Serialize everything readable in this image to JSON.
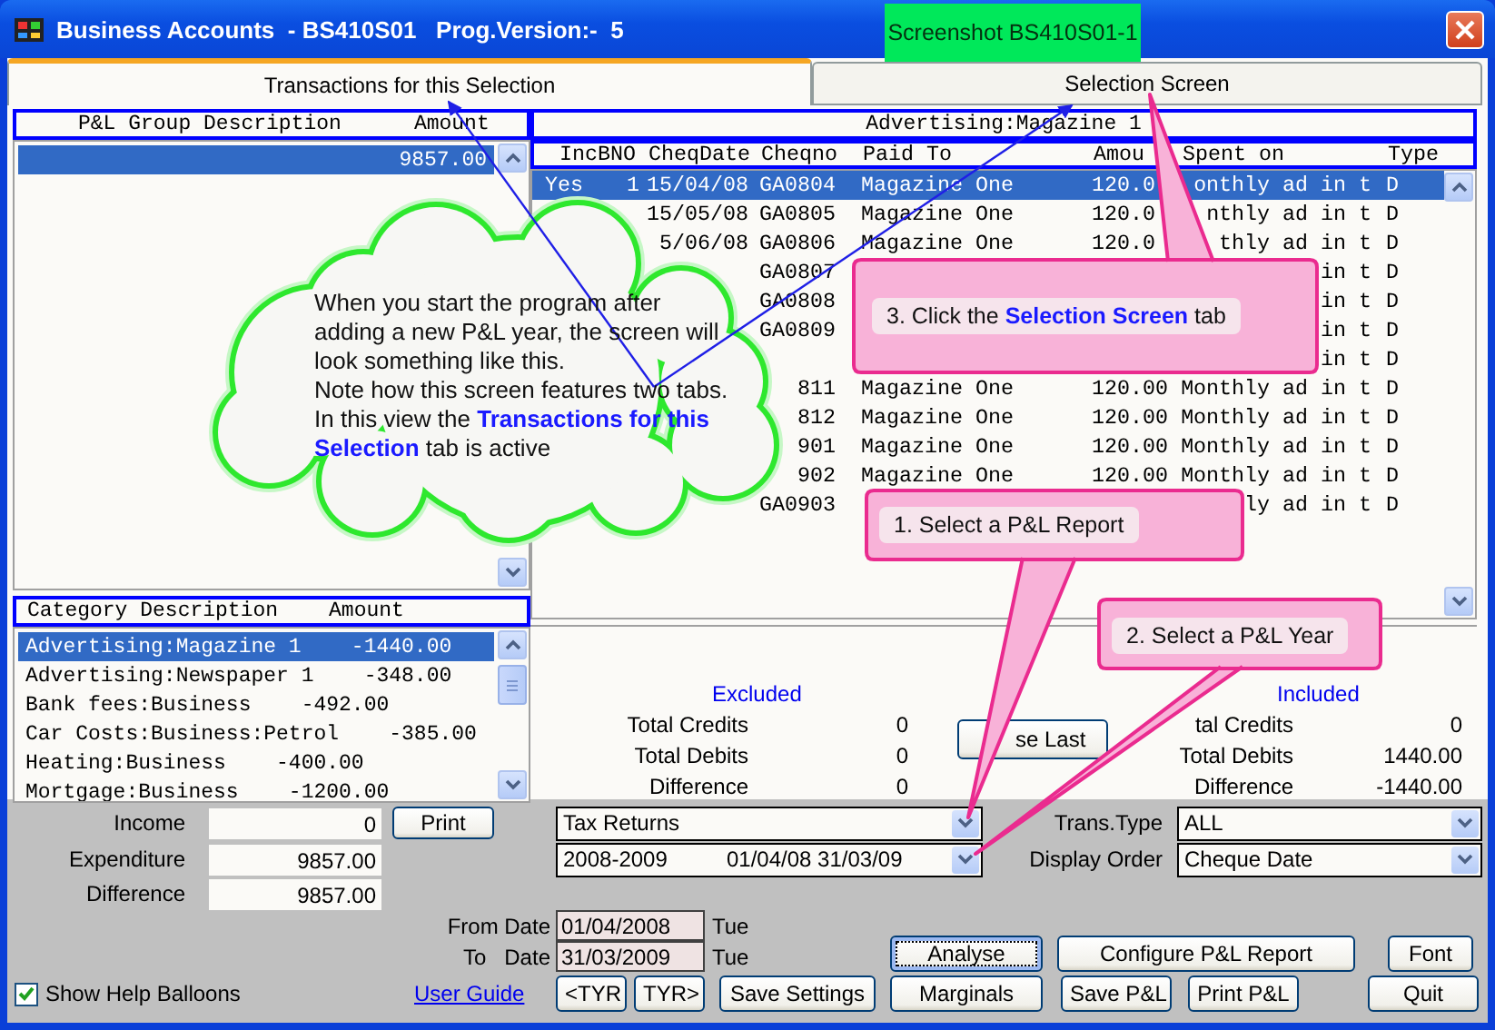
{
  "window": {
    "title": "Business Accounts  - BS410S01   Prog.Version:-  5"
  },
  "tabs": [
    {
      "label": "Transactions for this Selection",
      "selected": true
    },
    {
      "label": "Selection Screen",
      "selected": false
    }
  ],
  "group_list": {
    "columns": [
      "P&L Group Description",
      "Amount"
    ],
    "rows": [
      {
        "amount": "9857.00",
        "selected": true
      }
    ]
  },
  "category_list": {
    "columns": [
      "Category Description",
      "Amount"
    ],
    "rows": [
      {
        "description": "Advertising:Magazine 1",
        "amount": "-1440.00",
        "selected": true
      },
      {
        "description": "Advertising:Newspaper 1",
        "amount": "-348.00",
        "selected": false
      },
      {
        "description": "Bank fees:Business",
        "amount": "-492.00",
        "selected": false
      },
      {
        "description": "Car Costs:Business:Petrol",
        "amount": "-385.00",
        "selected": false
      },
      {
        "description": "Heating:Business",
        "amount": "-400.00",
        "selected": false
      },
      {
        "description": "Mortgage:Business",
        "amount": "-1200.00",
        "selected": false
      }
    ]
  },
  "transactions": {
    "title": "Advertising:Magazine 1",
    "columns": [
      "Inc",
      "BNO",
      "CheqDate",
      "Cheqno",
      "Paid To",
      "Amou",
      "Spent on",
      "Type"
    ],
    "rows": [
      {
        "inc": "Yes",
        "bno": "1",
        "date": "15/04/08",
        "cheqno": "GA0804",
        "paid_to": "Magazine One",
        "amount": "120.0",
        "spent_on": "onthly ad in t",
        "type": "D",
        "selected": true
      },
      {
        "date": "15/05/08",
        "cheqno": "GA0805",
        "paid_to": "Magazine One",
        "amount": "120.0",
        "spent_on": "nthly ad in t",
        "type": "D",
        "selected": false
      },
      {
        "date": "5/06/08",
        "cheqno": "GA0806",
        "paid_to": "Magazine One",
        "amount": "120.0",
        "spent_on": "thly ad in t",
        "type": "D",
        "selected": false
      },
      {
        "cheqno": "GA0807",
        "spent_on": "in t",
        "type": "D",
        "selected": false
      },
      {
        "cheqno": "GA0808",
        "spent_on": "in t",
        "type": "D",
        "selected": false
      },
      {
        "cheqno": "GA0809",
        "spent_on": "in t",
        "type": "D",
        "selected": false
      },
      {
        "spent_on": "in t",
        "type": "D",
        "selected": false
      },
      {
        "cheqno": "811",
        "paid_to": "Magazine One",
        "amount": "120.00",
        "spent_on": "Monthly ad in t",
        "type": "D",
        "selected": false
      },
      {
        "cheqno": "812",
        "paid_to": "Magazine One",
        "amount": "120.00",
        "spent_on": "Monthly ad in t",
        "type": "D",
        "selected": false
      },
      {
        "cheqno": "901",
        "paid_to": "Magazine One",
        "amount": "120.00",
        "spent_on": "Monthly ad in t",
        "type": "D",
        "selected": false
      },
      {
        "cheqno": "902",
        "paid_to": "Magazine One",
        "amount": "120.00",
        "spent_on": "Monthly ad in t",
        "type": "D",
        "selected": false
      },
      {
        "cheqno": "GA0903",
        "spent_on": "ly ad in t",
        "type": "D",
        "selected": false
      }
    ]
  },
  "summary": {
    "excluded": {
      "heading": "Excluded",
      "rows": [
        {
          "label": "Total Credits",
          "value": "0"
        },
        {
          "label": "Total Debits",
          "value": "0"
        },
        {
          "label": "Difference",
          "value": "0"
        }
      ]
    },
    "use_last": "se Last",
    "included": {
      "heading": "Included",
      "rows": [
        {
          "label": "tal Credits",
          "value": "0"
        },
        {
          "label": "Total Debits",
          "value": "1440.00"
        },
        {
          "label": "Difference",
          "value": "-1440.00"
        }
      ]
    }
  },
  "totals": [
    {
      "label": "Income",
      "value": "0"
    },
    {
      "label": "Expenditure",
      "value": "9857.00"
    },
    {
      "label": "Difference",
      "value": "9857.00"
    }
  ],
  "print_button": "Print",
  "report_select": {
    "value": "Tax Returns"
  },
  "year_select": {
    "year": "2008-2009",
    "range": "01/04/08 31/03/09"
  },
  "trans_type": {
    "label": "Trans.Type",
    "value": "ALL"
  },
  "display_order": {
    "label": "Display Order",
    "value": "Cheque Date"
  },
  "dates": [
    {
      "label": "From Date",
      "value": "01/04/2008",
      "day": "Tue"
    },
    {
      "label": "To   Date",
      "value": "31/03/2009",
      "day": "Tue"
    }
  ],
  "help_balloons": {
    "label": "Show Help Balloons",
    "checked": true
  },
  "user_guide": "User Guide",
  "buttons": [
    {
      "label": "Analyse",
      "focused": true
    },
    {
      "label": "Configure P&L Report",
      "focused": false
    },
    {
      "label": "Font",
      "focused": false
    },
    {
      "label": "<TYR",
      "focused": false
    },
    {
      "label": "TYR>",
      "focused": false
    },
    {
      "label": "Save Settings",
      "focused": false
    },
    {
      "label": "Marginals",
      "focused": false
    },
    {
      "label": "Save P&L",
      "focused": false
    },
    {
      "label": "Print P&L",
      "focused": false
    },
    {
      "label": "Quit",
      "focused": false
    }
  ],
  "annotations": {
    "screenshot_label": "Screenshot BS410S01-1",
    "cloud": "When you start the program after\nadding a new P&L year, the screen will\nlook something like this.\nNote how this screen features two tabs.\nIn this view the **Transactions for this**\n**Selection** tab is active",
    "callouts": [
      {
        "text": "3. Click the **Selection Screen** tab"
      },
      {
        "text": "1. Select a P&L Report"
      },
      {
        "text": "2. Select a P&L Year"
      }
    ]
  }
}
